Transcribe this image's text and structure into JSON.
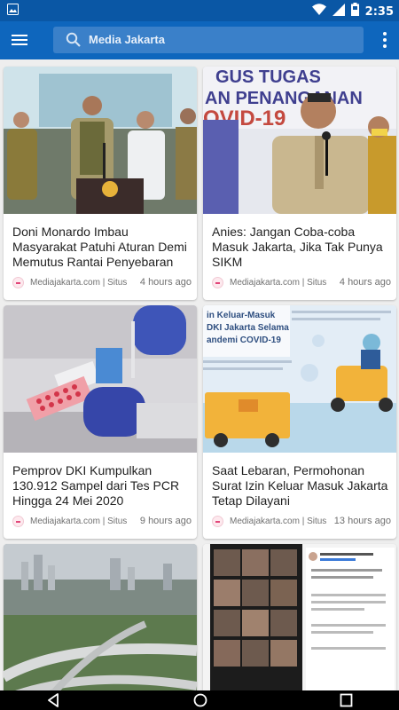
{
  "status_bar": {
    "time": "2:35",
    "icons": [
      "image-icon",
      "wifi-icon",
      "signal-icon",
      "battery-icon"
    ]
  },
  "app_bar": {
    "title": "Media Jakarta",
    "menu_icon": "hamburger-menu-icon",
    "search_icon": "search-icon",
    "overflow_icon": "more-vert-icon"
  },
  "colors": {
    "status_bar": "#0a57a5",
    "app_bar": "#0e66bd",
    "search_box": "#3a80c9",
    "background": "#eeeeee"
  },
  "cards": [
    {
      "title": "Doni Monardo Imbau Masyarakat Patuhi Aturan Demi Memutus Rantai Penyebaran",
      "source": "Mediajakarta.com | Situs Berita",
      "time": "4 hours ago",
      "image": "press-conference-photo"
    },
    {
      "title": "Anies: Jangan Coba-coba Masuk Jakarta, Jika Tak Punya SIKM",
      "source": "Mediajakarta.com | Situs Berita",
      "time": "4 hours ago",
      "image": "governor-speech-photo"
    },
    {
      "title": "Pemprov DKI Kumpulkan 130.912 Sampel dari Tes PCR Hingga 24 Mei 2020",
      "source": "Mediajakarta.com | Situs Berita",
      "time": "9 hours ago",
      "image": "pcr-test-lab-photo"
    },
    {
      "title": "Saat Lebaran, Permohonan Surat Izin Keluar Masuk Jakarta Tetap Dilayani",
      "source": "Mediajakarta.com | Situs Berita",
      "time": "13 hours ago",
      "image": "sikm-infographic"
    },
    {
      "title": "",
      "source": "",
      "time": "",
      "image": "jakarta-highway-aerial-photo"
    },
    {
      "title": "",
      "source": "",
      "time": "",
      "image": "video-call-collage-screenshot"
    }
  ],
  "card_image_texts": {
    "card2": "GUS TUGAS AN PENANGANAN OVID-19",
    "card4_heading_1": "in Keluar-Masuk",
    "card4_heading_2": "DKI Jakarta Selama",
    "card4_heading_3": "andemi COVID-19"
  },
  "nav_bar": {
    "icons": [
      "back-icon",
      "home-icon",
      "recents-icon"
    ]
  }
}
